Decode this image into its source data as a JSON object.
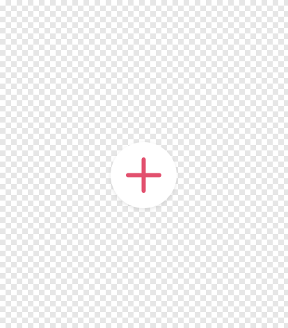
{
  "background": {
    "pattern": "transparency-checkerboard",
    "colors": [
      "#ffffff",
      "#e6e6e6"
    ]
  },
  "fab": {
    "icon": "plus-icon",
    "background_color": "#ffffff",
    "icon_color": "#e2506e"
  }
}
